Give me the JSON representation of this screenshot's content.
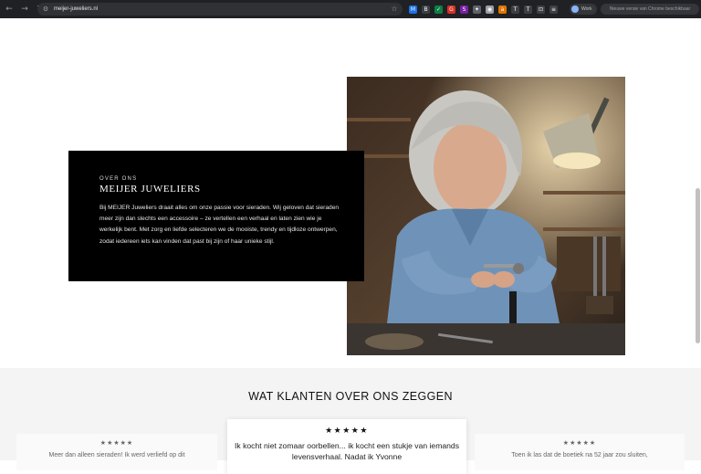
{
  "browser": {
    "url": "meijer-juweliers.nl",
    "profile_label": "Work",
    "update_text": "Nieuwe versie van Chrome beschikbaar",
    "extension_glyphs": [
      "M",
      "B",
      "✓",
      "G",
      "S",
      "✦",
      "◉",
      "a",
      "T",
      "T",
      "⊡",
      "≡"
    ]
  },
  "about": {
    "eyebrow": "OVER ONS",
    "title": "MEIJER JUWELIERS",
    "body": "Bij MEIJER Juweliers draait alles om onze passie voor sieraden. Wij geloven dat sieraden meer zijn dan slechts een accessoire – ze vertellen een verhaal en laten zien wie je werkelijk bent. Met zorg en liefde selecteren we de mooiste, trendy en tijdloze ontwerpen, zodat iedereen iets kan vinden dat past bij zijn of haar unieke stijl."
  },
  "reviews": {
    "heading": "WAT KLANTEN OVER ONS ZEGGEN",
    "items": [
      {
        "stars": "★★★★★",
        "quote": "Meer dan alleen sieraden! Ik werd verliefd op dit"
      },
      {
        "stars": "★★★★★",
        "quote": "Ik kocht niet zomaar oorbellen... ik kocht een stukje van iemands levensverhaal. Nadat ik Yvonne"
      },
      {
        "stars": "★★★★★",
        "quote": "Toen ik las dat de boetiek na 52 jaar zou sluiten,"
      }
    ]
  },
  "colors": {
    "chrome_bg": "#202124",
    "card_bg": "#000000",
    "section_bg": "#f4f4f4"
  }
}
